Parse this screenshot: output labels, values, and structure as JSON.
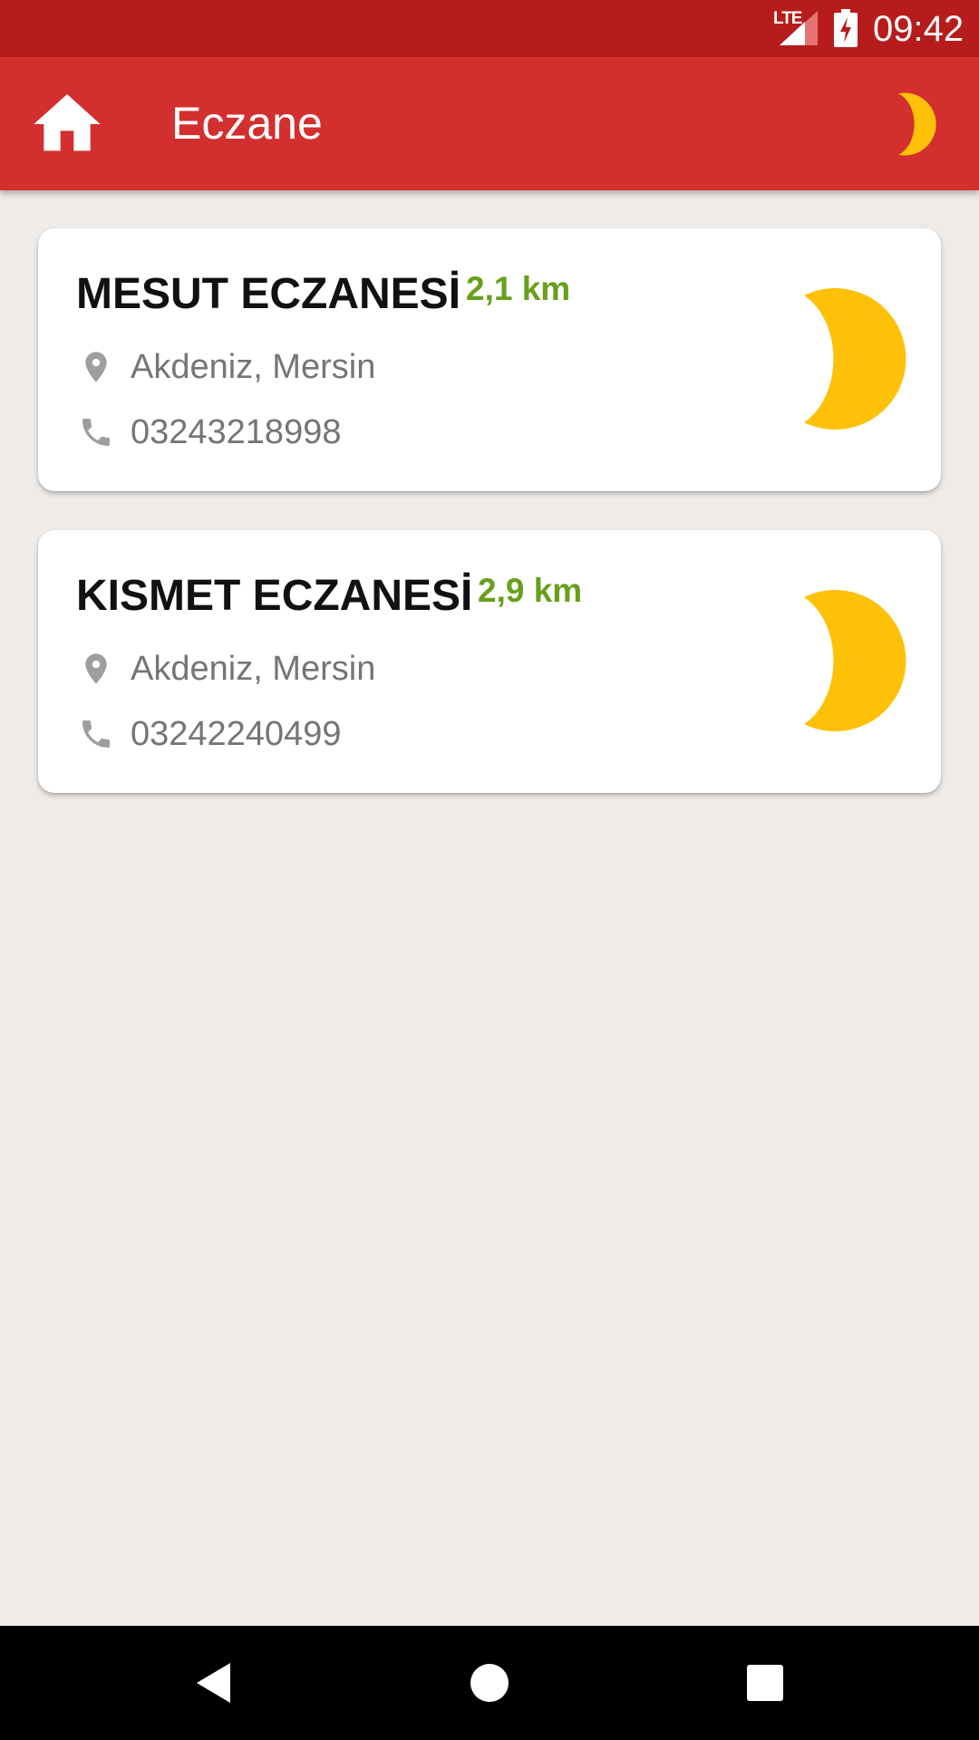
{
  "status_bar": {
    "network_type": "LTE",
    "time": "09:42",
    "icons": [
      "lte-signal-icon",
      "battery-charging-icon"
    ]
  },
  "app_bar": {
    "title": "Eczane",
    "home_icon": "home-icon",
    "night_icon": "moon-icon"
  },
  "colors": {
    "status_bar": "#b71c1c",
    "app_bar": "#d32f2f",
    "background": "#efebe9",
    "distance": "#689f1c",
    "moon": "#ffc107",
    "secondary_text": "#757575"
  },
  "pharmacies": [
    {
      "name": "MESUT ECZANESİ",
      "distance": "2,1 km",
      "location": "Akdeniz, Mersin",
      "phone": "03243218998",
      "status_icon": "moon-icon"
    },
    {
      "name": "KISMET ECZANESİ",
      "distance": "2,9 km",
      "location": "Akdeniz, Mersin",
      "phone": "03242240499",
      "status_icon": "moon-icon"
    }
  ],
  "nav_bar": {
    "buttons": [
      "back-icon",
      "home-circle-icon",
      "recents-icon"
    ]
  }
}
